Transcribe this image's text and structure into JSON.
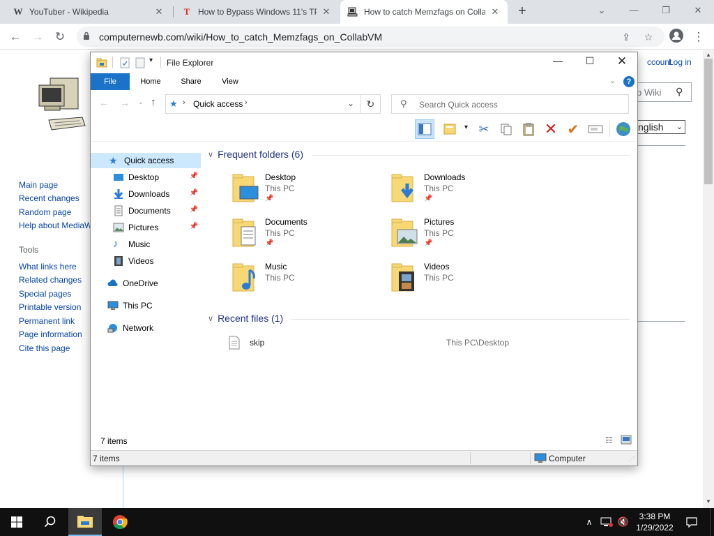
{
  "browser": {
    "tabs": [
      {
        "favicon": "W",
        "title": "YouTuber - Wikipedia"
      },
      {
        "favicon": "T",
        "title": "How to Bypass Windows 11's TP"
      },
      {
        "favicon": "computer",
        "title": "How to catch Memzfags on Colla"
      }
    ],
    "active_tab": 2,
    "new_tab_label": "+",
    "url": "computernewb.com/wiki/How_to_catch_Memzfags_on_CollabVM"
  },
  "wiki": {
    "top_links": {
      "account": "ccount",
      "login": "Log in"
    },
    "search_placeholder": "b Wiki",
    "language": "nglish",
    "nav": [
      "Main page",
      "Recent changes",
      "Random page",
      "Help about MediaW"
    ],
    "tools_heading": "Tools",
    "tools": [
      "What links here",
      "Related changes",
      "Special pages",
      "Printable version",
      "Permanent link",
      "Page information",
      "Cite this page"
    ]
  },
  "explorer": {
    "title": "File Explorer",
    "ribbon_tabs": [
      "File",
      "Home",
      "Share",
      "View"
    ],
    "address": "Quick access",
    "search_placeholder": "Search Quick access",
    "nav_pane": [
      {
        "label": "Quick access",
        "icon": "star-icon",
        "pinned": false,
        "selected": true
      },
      {
        "label": "Desktop",
        "icon": "desktop-icon",
        "pinned": true
      },
      {
        "label": "Downloads",
        "icon": "download-icon",
        "pinned": true
      },
      {
        "label": "Documents",
        "icon": "document-icon",
        "pinned": true
      },
      {
        "label": "Pictures",
        "icon": "picture-icon",
        "pinned": true
      },
      {
        "label": "Music",
        "icon": "music-icon",
        "pinned": false
      },
      {
        "label": "Videos",
        "icon": "video-icon",
        "pinned": false
      },
      {
        "label": "OneDrive",
        "icon": "cloud-icon",
        "pinned": false
      },
      {
        "label": "This PC",
        "icon": "computer-icon",
        "pinned": false
      },
      {
        "label": "Network",
        "icon": "network-icon",
        "pinned": false
      }
    ],
    "frequent_heading": "Frequent folders (6)",
    "frequent": [
      {
        "name": "Desktop",
        "location": "This PC",
        "pinned": true,
        "overlay": "desktop"
      },
      {
        "name": "Downloads",
        "location": "This PC",
        "pinned": true,
        "overlay": "download"
      },
      {
        "name": "Documents",
        "location": "This PC",
        "pinned": true,
        "overlay": "document"
      },
      {
        "name": "Pictures",
        "location": "This PC",
        "pinned": true,
        "overlay": "picture"
      },
      {
        "name": "Music",
        "location": "This PC",
        "pinned": false,
        "overlay": "music"
      },
      {
        "name": "Videos",
        "location": "This PC",
        "pinned": false,
        "overlay": "video"
      }
    ],
    "recent_heading": "Recent files (1)",
    "recent": [
      {
        "name": "skip",
        "path": "This PC\\Desktop"
      }
    ],
    "status_items": "7 items",
    "status_bar_items": "7 items",
    "status_bar_location": "Computer"
  },
  "taskbar": {
    "time": "3:38 PM",
    "date": "1/29/2022"
  },
  "colors": {
    "file_tab": "#1a73c8",
    "group_heading": "#1e3287",
    "wiki_link": "#0645ad",
    "taskbar": "#101010",
    "folder_yellow": "#f8d775"
  }
}
